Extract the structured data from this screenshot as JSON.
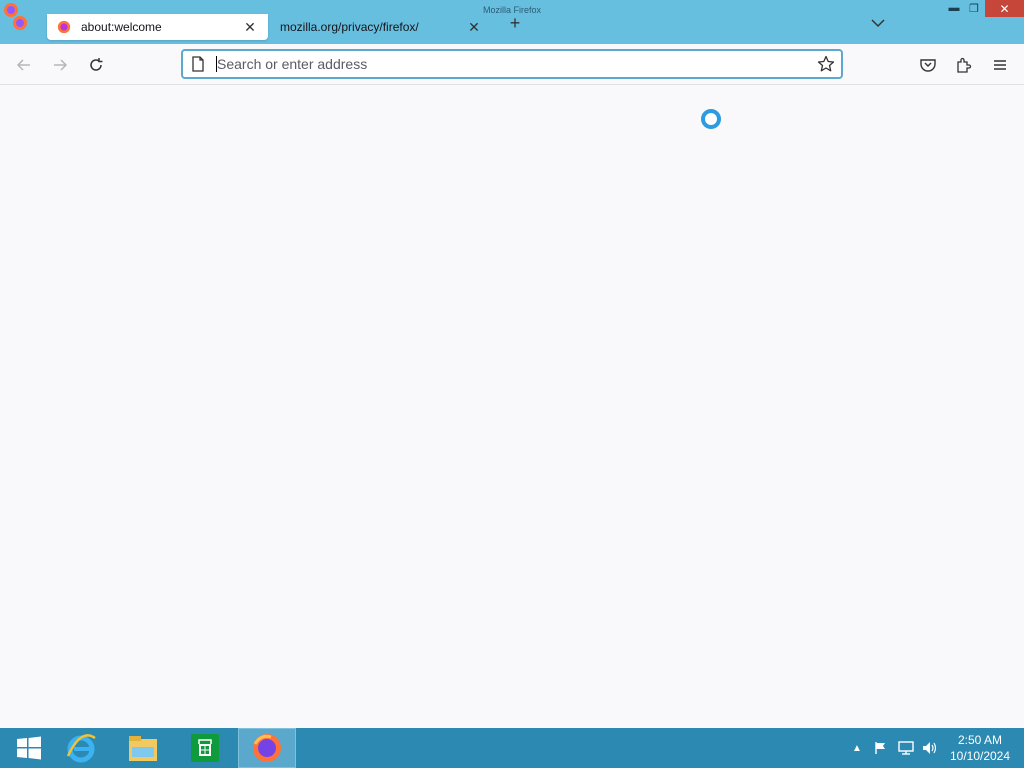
{
  "window": {
    "title": "Mozilla Firefox"
  },
  "tabs": [
    {
      "label": "about:welcome",
      "active": true
    },
    {
      "label": "mozilla.org/privacy/firefox/",
      "active": false
    }
  ],
  "urlbar": {
    "placeholder": "Search or enter address",
    "value": ""
  },
  "colors": {
    "tabstrip": "#67bfe0",
    "accent": "#5da8cf",
    "taskbar": "#2b89b2",
    "close": "#c7463a"
  },
  "taskbar": {
    "apps": [
      "windows-start-icon",
      "internet-explorer-icon",
      "file-explorer-icon",
      "store-icon",
      "firefox-icon"
    ],
    "clock": {
      "time": "2:50 AM",
      "date": "10/10/2024"
    }
  }
}
